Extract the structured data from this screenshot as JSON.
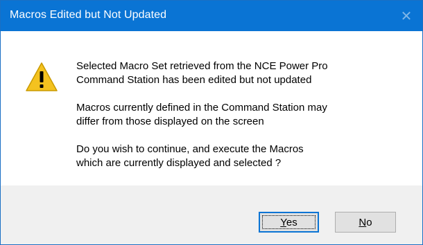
{
  "window": {
    "title": "Macros Edited but Not Updated",
    "close_glyph": "✕"
  },
  "icon": {
    "name": "warning-icon",
    "color": "#f4c21f"
  },
  "message": {
    "paragraph1_line1": "Selected Macro Set retrieved from the NCE Power Pro",
    "paragraph1_line2": "Command Station has been edited but not updated",
    "paragraph2_line1": "Macros currently defined in the Command Station may",
    "paragraph2_line2": "differ from those displayed on the screen",
    "paragraph3_line1": "Do you wish to continue, and execute the Macros",
    "paragraph3_line2": "which are currently displayed and selected ?"
  },
  "buttons": {
    "yes_accel": "Y",
    "yes_rest": "es",
    "no_accel": "N",
    "no_rest": "o"
  },
  "colors": {
    "titlebar": "#0a74d4",
    "footer": "#f0f0f0"
  }
}
